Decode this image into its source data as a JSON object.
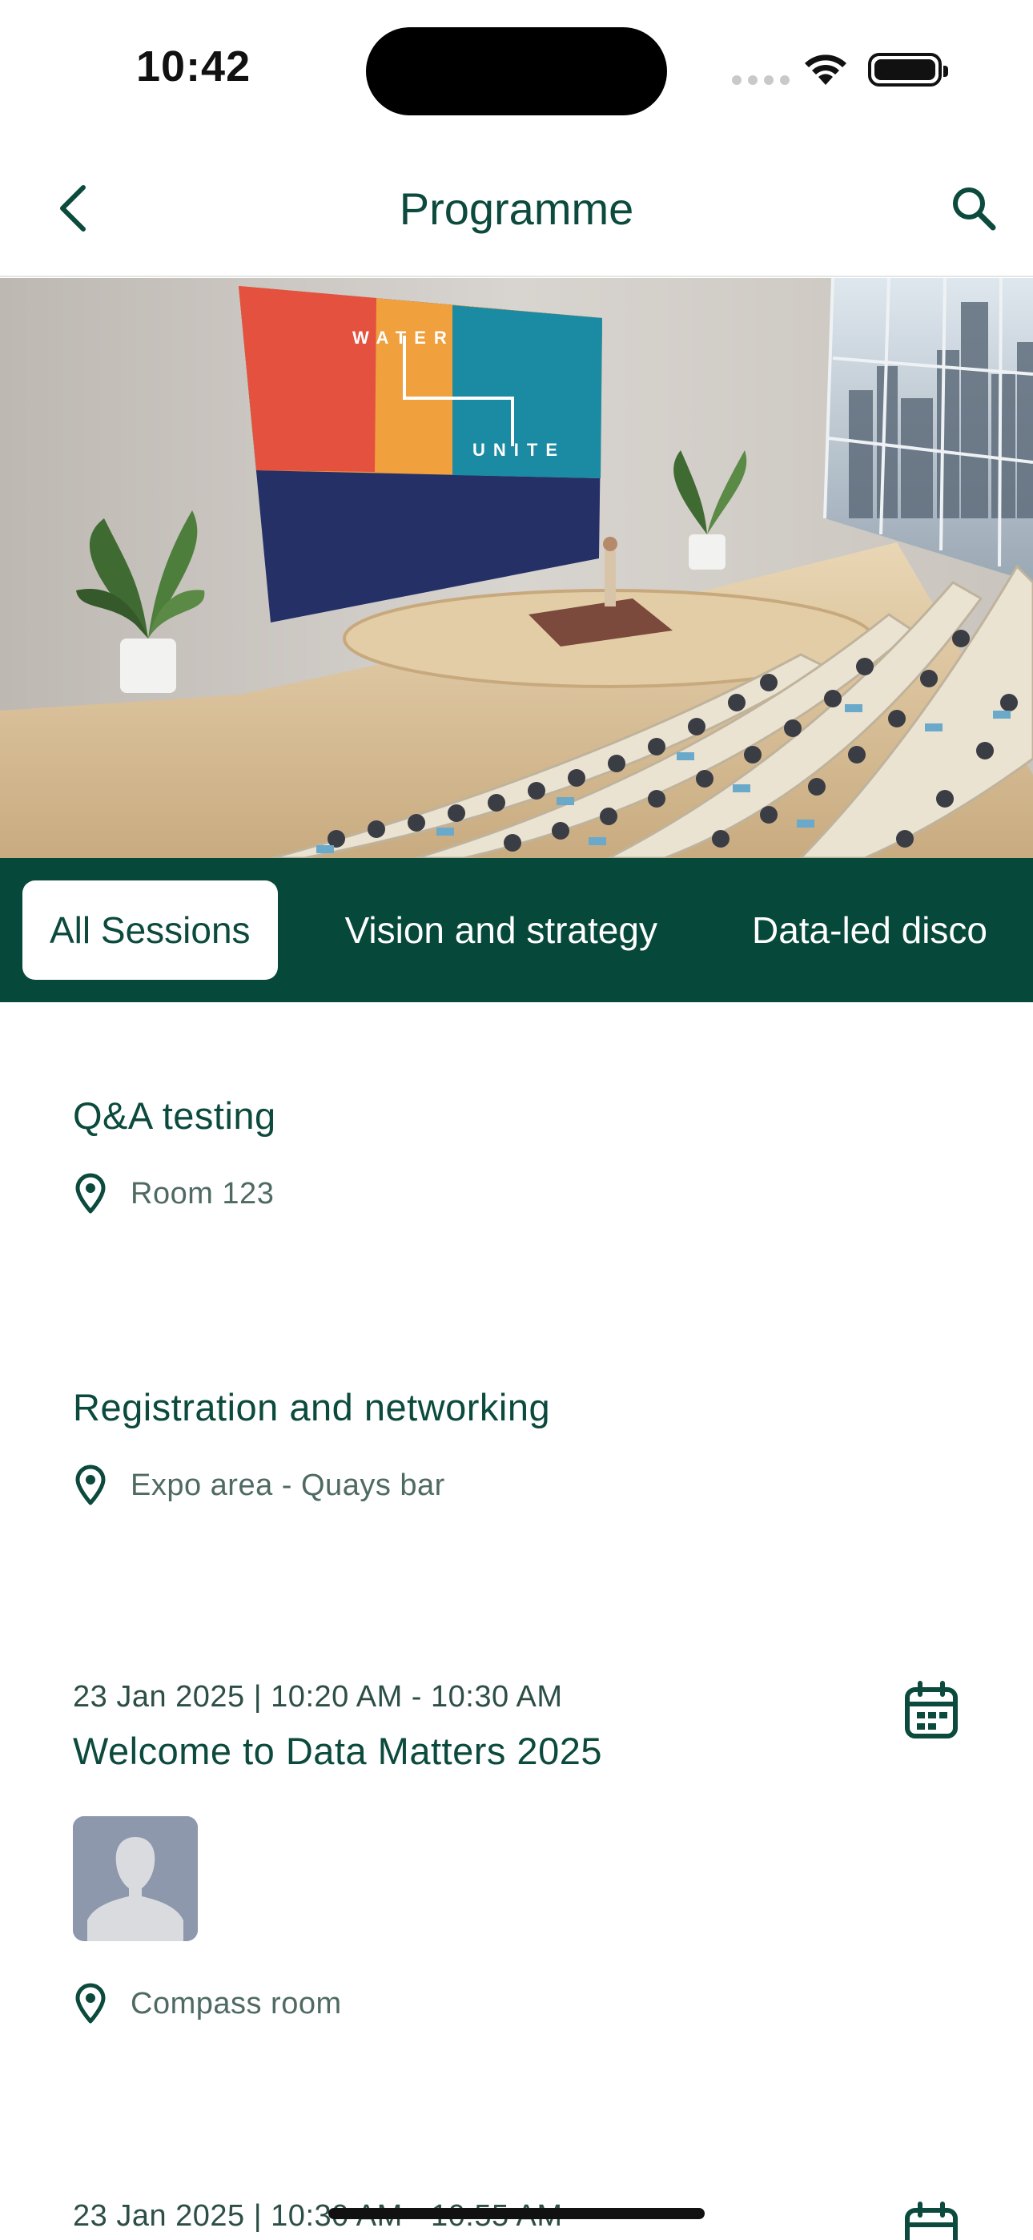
{
  "status_bar": {
    "time": "10:42"
  },
  "header": {
    "title": "Programme",
    "back_icon": "chevron-left-icon",
    "search_icon": "search-icon"
  },
  "hero": {
    "screen_text_top": "WATER",
    "screen_text_bottom": "UNITE"
  },
  "tabs": [
    {
      "label": "All Sessions",
      "active": true
    },
    {
      "label": "Vision and strategy",
      "active": false
    },
    {
      "label": "Data-led disco",
      "active": false
    }
  ],
  "sessions": [
    {
      "date": "",
      "title": "Q&A testing",
      "location": "Room 123"
    },
    {
      "date": "",
      "title": "Registration and networking",
      "location": "Expo area - Quays bar"
    },
    {
      "date": "23 Jan 2025 | 10:20 AM - 10:30 AM",
      "title": "Welcome to Data Matters 2025",
      "location": "Compass room"
    },
    {
      "date": "23 Jan 2025 | 10:30 AM - 10:55 AM"
    }
  ],
  "colors": {
    "brand_green": "#06493a",
    "text_green": "#0b4a3c",
    "muted": "#4f6a63"
  }
}
